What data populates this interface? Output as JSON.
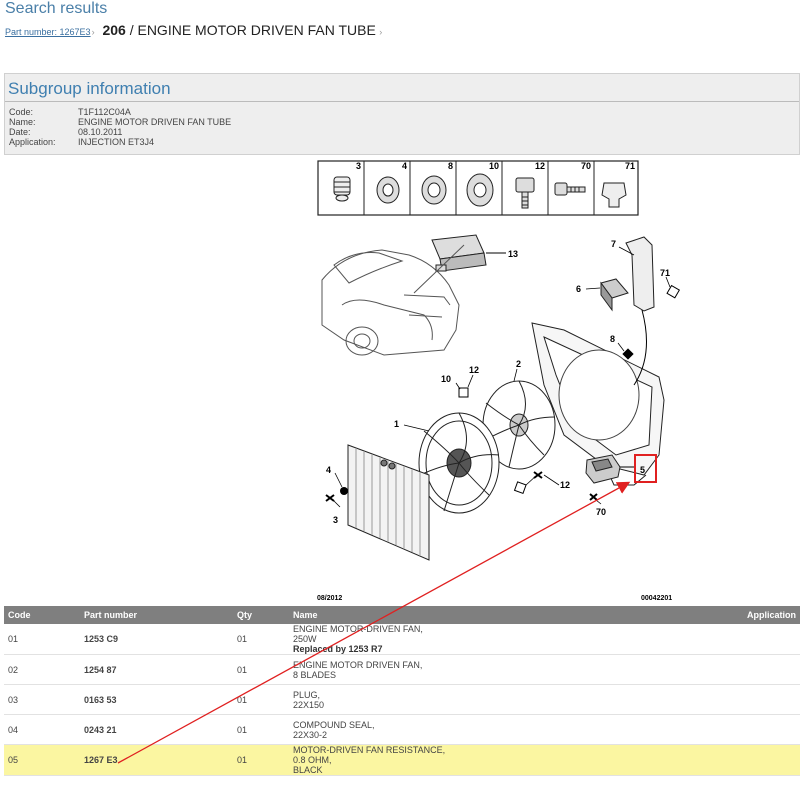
{
  "search_title": "Search results",
  "breadcrumb": {
    "part_link": "Part number: 1267E3",
    "model": "206",
    "separator": "/",
    "subgroup": "ENGINE MOTOR DRIVEN FAN TUBE"
  },
  "subgroup_info": {
    "title": "Subgroup information",
    "code_label": "Code:",
    "code": "T1F112C04A",
    "name_label": "Name:",
    "name": "ENGINE MOTOR DRIVEN FAN TUBE",
    "date_label": "Date:",
    "date": "08.10.2011",
    "application_label": "Application:",
    "application": "INJECTION ET3J4"
  },
  "diagram": {
    "legend_numbers": [
      "3",
      "4",
      "8",
      "10",
      "12",
      "70",
      "71"
    ],
    "callouts": [
      "13",
      "7",
      "71",
      "6",
      "8",
      "2",
      "12",
      "10",
      "1",
      "4",
      "3",
      "12",
      "5",
      "70"
    ],
    "date_code": "08/2012",
    "image_code": "00042201",
    "highlight_color": "#e02020"
  },
  "table": {
    "headers": {
      "code": "Code",
      "part_number": "Part number",
      "qty": "Qty",
      "name": "Name",
      "application": "Application"
    },
    "rows": [
      {
        "code": "01",
        "part": "1253 C9",
        "qty": "01",
        "name1": "ENGINE MOTOR-DRIVEN FAN,",
        "name2": "250W",
        "name3": "Replaced by 1253 R7"
      },
      {
        "code": "02",
        "part": "1254 87",
        "qty": "01",
        "name1": "ENGINE MOTOR DRIVEN FAN,",
        "name2": "8 BLADES",
        "name3": ""
      },
      {
        "code": "03",
        "part": "0163 53",
        "qty": "01",
        "name1": "PLUG,",
        "name2": "22X150",
        "name3": ""
      },
      {
        "code": "04",
        "part": "0243 21",
        "qty": "01",
        "name1": "COMPOUND SEAL,",
        "name2": "22X30-2",
        "name3": ""
      },
      {
        "code": "05",
        "part": "1267 E3",
        "qty": "01",
        "name1": "MOTOR-DRIVEN FAN RESISTANCE,",
        "name2": "0.8 OHM,",
        "name3": "BLACK"
      }
    ],
    "highlight_row_color": "#fbf6a1"
  }
}
